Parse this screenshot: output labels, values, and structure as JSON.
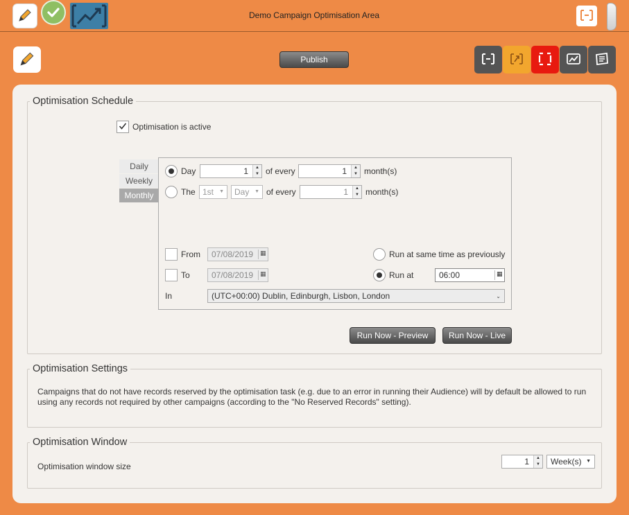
{
  "app": {
    "title": "Demo Campaign Optimisation Area"
  },
  "top_icons": [
    "pencil-icon",
    "checkmark-icon",
    "chart-trend-icon",
    "fit-frame-icon",
    "side-handle"
  ],
  "toolbar": {
    "publish_label": "Publish",
    "view_icons": [
      "fit-frame-icon",
      "expand-diagonal-icon",
      "frame-red-icon",
      "chart-line-icon",
      "list-card-icon"
    ]
  },
  "colors": {
    "background": "#ee8a46",
    "panel": "#f4f1ed",
    "amber": "#f2a62e",
    "red": "#e81a0f",
    "dark_button": "#545454"
  },
  "schedule": {
    "legend": "Optimisation Schedule",
    "active_label": "Optimisation is active",
    "active_checked": true,
    "tabs": [
      "Daily",
      "Weekly",
      "Monthly"
    ],
    "active_tab": "Monthly",
    "row_day": {
      "label": "Day",
      "day_value": "1",
      "of_every": "of every",
      "month_value": "1",
      "months": "month(s)",
      "selected": true
    },
    "row_the": {
      "label": "The",
      "ordinal": "1st",
      "day_type": "Day",
      "of_every": "of every",
      "month_value": "1",
      "months": "month(s)",
      "selected": false
    },
    "from": {
      "label": "From",
      "date": "07/08/2019",
      "checked": false
    },
    "to": {
      "label": "To",
      "date": "07/08/2019",
      "checked": false
    },
    "run_same": {
      "label": "Run at same time as previously",
      "selected": false
    },
    "run_at": {
      "label": "Run at",
      "time": "06:00",
      "selected": true
    },
    "in_label": "In",
    "timezone": "(UTC+00:00) Dublin, Edinburgh, Lisbon, London",
    "run_preview": "Run Now -  Preview",
    "run_live": "Run Now - Live"
  },
  "settings": {
    "legend": "Optimisation Settings",
    "text": "Campaigns that do not have records reserved by the optimisation task (e.g. due to an error in running their Audience) will by default be allowed to run using any records not required by other campaigns (according to the \"No Reserved Records\" setting)."
  },
  "window": {
    "legend": "Optimisation Window",
    "size_label": "Optimisation window size",
    "size_value": "1",
    "unit": "Week(s)"
  }
}
